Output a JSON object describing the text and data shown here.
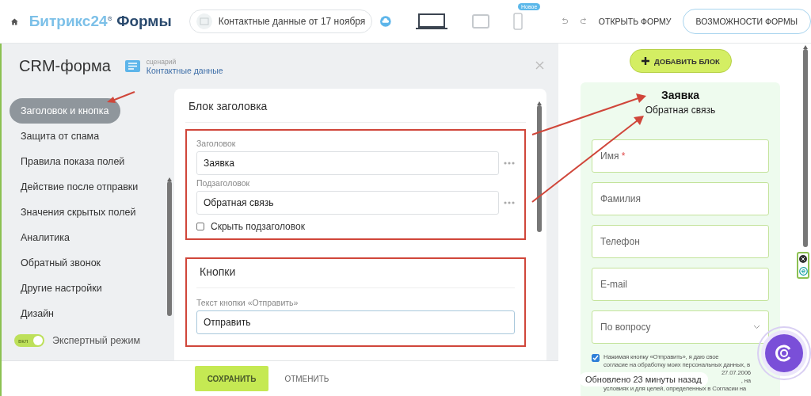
{
  "header": {
    "logo_brand": "Битрикс24",
    "logo_product": "Формы",
    "form_name": "Контактные данные от 17 ноября",
    "devices": [
      {
        "kind": "laptop",
        "selected": true
      },
      {
        "kind": "tablet",
        "selected": false
      },
      {
        "kind": "phone",
        "selected": false,
        "badge": "Новое"
      }
    ],
    "open_form": "ОТКРЫТЬ ФОРМУ",
    "features": "ВОЗМОЖНОСТИ ФОРМЫ"
  },
  "panel": {
    "title": "CRM-форма",
    "scenario_label": "сценарий",
    "scenario": "Контактные данные"
  },
  "sidebar": {
    "items": [
      {
        "label": "Заголовок и кнопка",
        "selected": true
      },
      {
        "label": "Защита от спама",
        "selected": false
      },
      {
        "label": "Правила показа полей",
        "selected": false
      },
      {
        "label": "Действие после отправки",
        "selected": false
      },
      {
        "label": "Значения скрытых полей",
        "selected": false
      },
      {
        "label": "Аналитика",
        "selected": false
      },
      {
        "label": "Обратный звонок",
        "selected": false
      },
      {
        "label": "Другие настройки",
        "selected": false
      },
      {
        "label": "Дизайн",
        "selected": false
      }
    ],
    "expert_mode": {
      "label": "Экспертный режим",
      "toggle_text": "вкл",
      "on": true
    }
  },
  "header_block": {
    "title": "Блок заголовка",
    "fields": [
      {
        "label": "Заголовок",
        "value": "Заявка"
      },
      {
        "label": "Подзаголовок",
        "value": "Обратная связь"
      }
    ],
    "hide_subtitle": {
      "label": "Скрыть подзаголовок",
      "checked": false
    }
  },
  "buttons_block": {
    "title": "Кнопки",
    "field": {
      "label": "Текст кнопки «Отправить»",
      "value": "Отправить"
    }
  },
  "footer": {
    "save": "СОХРАНИТЬ",
    "cancel": "ОТМЕНИТЬ"
  },
  "preview": {
    "add_block": "ДОБАВИТЬ БЛОК",
    "title": "Заявка",
    "subtitle": "Обратная связь",
    "required_mark": "*",
    "fields": [
      {
        "placeholder": "Имя",
        "required": true,
        "kind": "text"
      },
      {
        "placeholder": "Фамилия",
        "required": false,
        "kind": "text"
      },
      {
        "placeholder": "Телефон",
        "required": false,
        "kind": "text"
      },
      {
        "placeholder": "E-mail",
        "required": false,
        "kind": "text"
      },
      {
        "placeholder": "По вопросу",
        "required": false,
        "kind": "select"
      }
    ],
    "consent": {
      "checked": true,
      "lines": [
        "Нажимая кнопку «Отправить», я даю свое",
        "согласие на обработку моих персональных данных, в",
        "27.07.2006",
        ", на",
        "условиях и для целей, определенных в Согласии на"
      ]
    }
  },
  "toast": "Обновлено 23 минуты назад"
}
